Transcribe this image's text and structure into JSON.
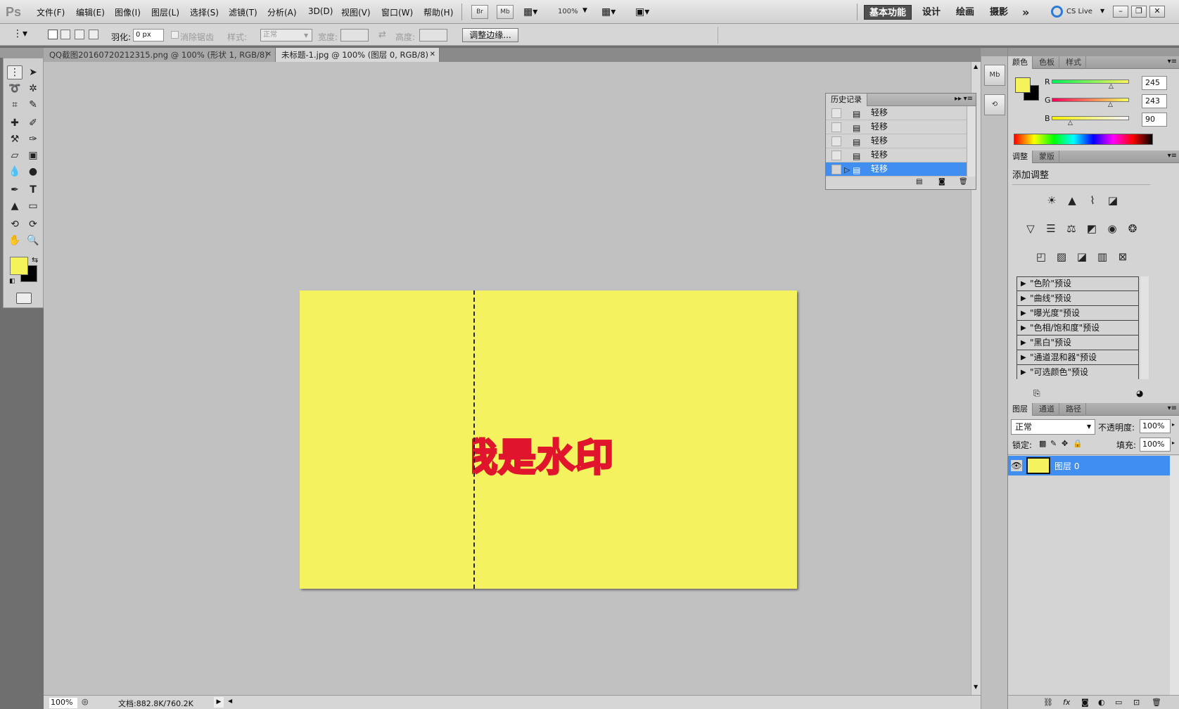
{
  "app": {
    "logo": "Ps"
  },
  "menu": [
    "文件(F)",
    "编辑(E)",
    "图像(I)",
    "图层(L)",
    "选择(S)",
    "滤镜(T)",
    "分析(A)",
    "3D(D)",
    "视图(V)",
    "窗口(W)",
    "帮助(H)"
  ],
  "appbar": {
    "br": "Br",
    "mb": "Mb",
    "zoom": "100%"
  },
  "workspaces": {
    "active": "基本功能",
    "items": [
      "设计",
      "绘画",
      "摄影"
    ],
    "more": "»",
    "cslive": "CS Live"
  },
  "window_buttons": [
    "–",
    "❐",
    "✕"
  ],
  "options": {
    "feather_label": "羽化:",
    "feather_value": "0 px",
    "antialias_label": "消除锯齿",
    "style_label": "样式:",
    "style_value": "正常",
    "width_label": "宽度:",
    "height_label": "高度:",
    "refine_button": "调整边缘..."
  },
  "tabs": [
    {
      "title": "QQ截图20160720212315.png @ 100% (形状 1, RGB/8) *",
      "close": "✕"
    },
    {
      "title": "未标题-1.jpg @ 100% (图层 0, RGB/8) *",
      "close": "✕"
    }
  ],
  "canvas": {
    "watermark": "我是水印",
    "bg_color": "#f5f25f",
    "text_color": "#e0152d"
  },
  "status": {
    "zoom": "100%",
    "doc": "文档:882.8K/760.2K"
  },
  "history": {
    "title": "历史记录",
    "rows": [
      "轻移",
      "轻移",
      "轻移",
      "轻移",
      "轻移"
    ],
    "active_index": 4
  },
  "right_strip": {
    "mb": "Mb"
  },
  "color_panel": {
    "tabs": [
      "颜色",
      "色板",
      "样式"
    ],
    "r_label": "R",
    "g_label": "G",
    "b_label": "B",
    "r": "245",
    "g": "243",
    "b": "90",
    "fg": "#f5f35a",
    "bg": "#000000"
  },
  "adjust_panel": {
    "tabs": [
      "调整",
      "蒙版"
    ],
    "title": "添加调整",
    "presets": [
      "\"色阶\"预设",
      "\"曲线\"预设",
      "\"曝光度\"预设",
      "\"色相/饱和度\"预设",
      "\"黑白\"预设",
      "\"通道混和器\"预设",
      "\"可选颜色\"预设"
    ]
  },
  "layers_panel": {
    "tabs": [
      "图层",
      "通道",
      "路径"
    ],
    "blend": "正常",
    "opacity_label": "不透明度:",
    "opacity": "100%",
    "lock_label": "锁定:",
    "fill_label": "填充:",
    "fill": "100%",
    "layer_name": "图层 0"
  }
}
